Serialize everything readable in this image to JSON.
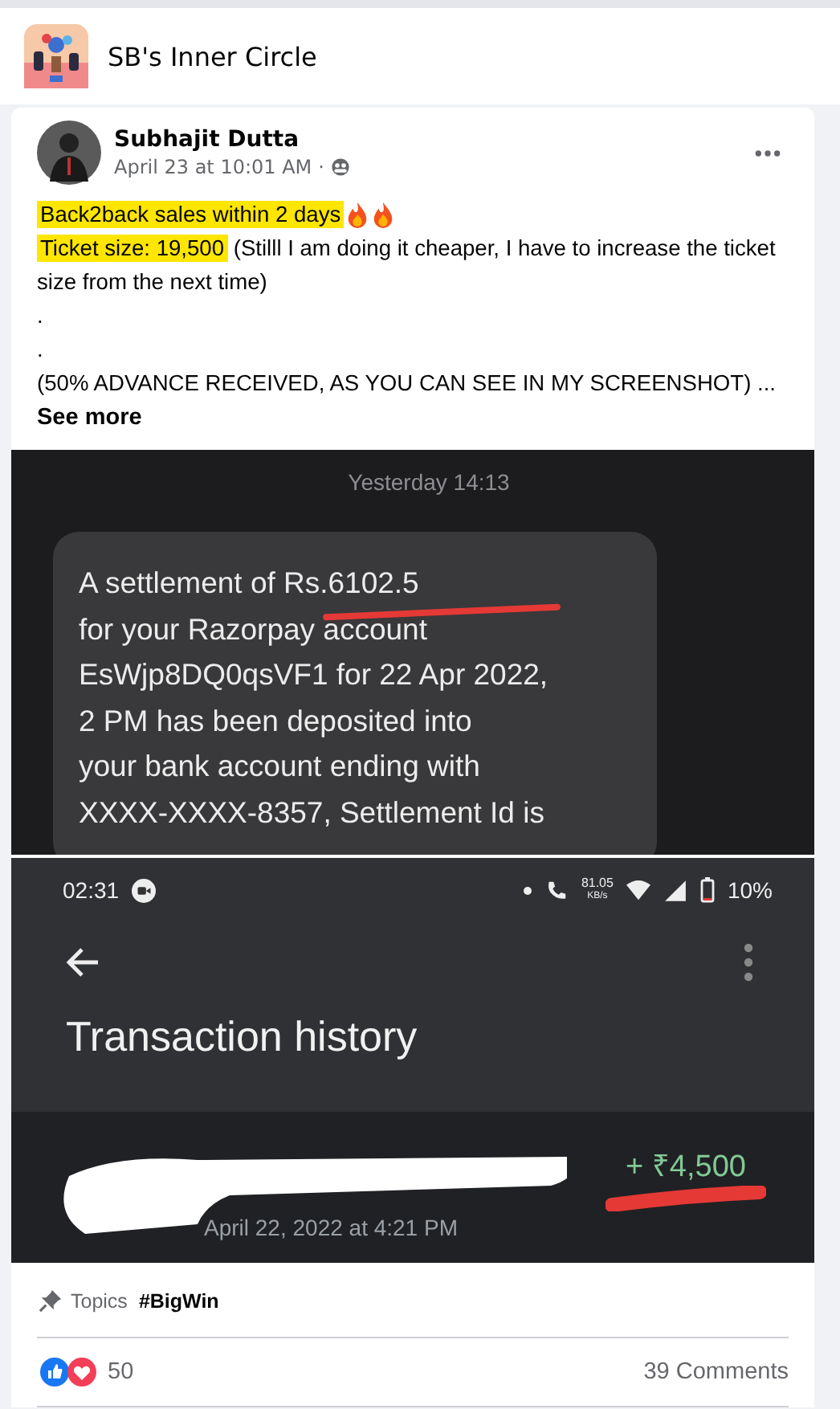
{
  "group": {
    "name": "SB's Inner Circle"
  },
  "post": {
    "author": "Subhajit Dutta",
    "time": "April 23 at 10:01 AM",
    "separator": "·",
    "body": [
      {
        "highlight": "Back2back sales within 2 days",
        "flames": true
      },
      {
        "highlight": "Ticket size: 19,500",
        "rest": " (Stilll I am doing it cheaper, I have to increase the ticket size from the next time)",
        "flames": false
      },
      {
        "rest": ".",
        "flames": false
      },
      {
        "rest": ".",
        "flames": false
      },
      {
        "rest": "(50% ADVANCE RECEIVED, AS YOU CAN SEE IN MY SCREENSHOT)  ...",
        "flames": false
      }
    ],
    "see_more": "See more"
  },
  "sms_screenshot": {
    "timestamp": "Yesterday 14:13",
    "message_lines": [
      "A settlement of Rs.6102.5",
      "for your Razorpay account",
      "EsWjp8DQ0qsVF1 for 22 Apr 2022,",
      "2 PM has been deposited into",
      "your bank account ending with",
      "XXXX-XXXX-8357, Settlement Id is"
    ]
  },
  "payment_screenshot": {
    "clock": "02:31",
    "speed_value": "81.05",
    "speed_unit": "KB/s",
    "battery": "10%",
    "title": "Transaction history",
    "amount": "+ ₹4,500",
    "date": "April 22, 2022 at 4:21 PM"
  },
  "topics": {
    "label": "Topics",
    "tag": "#BigWin"
  },
  "reactions": {
    "count": "50",
    "comments": "39 Comments"
  }
}
